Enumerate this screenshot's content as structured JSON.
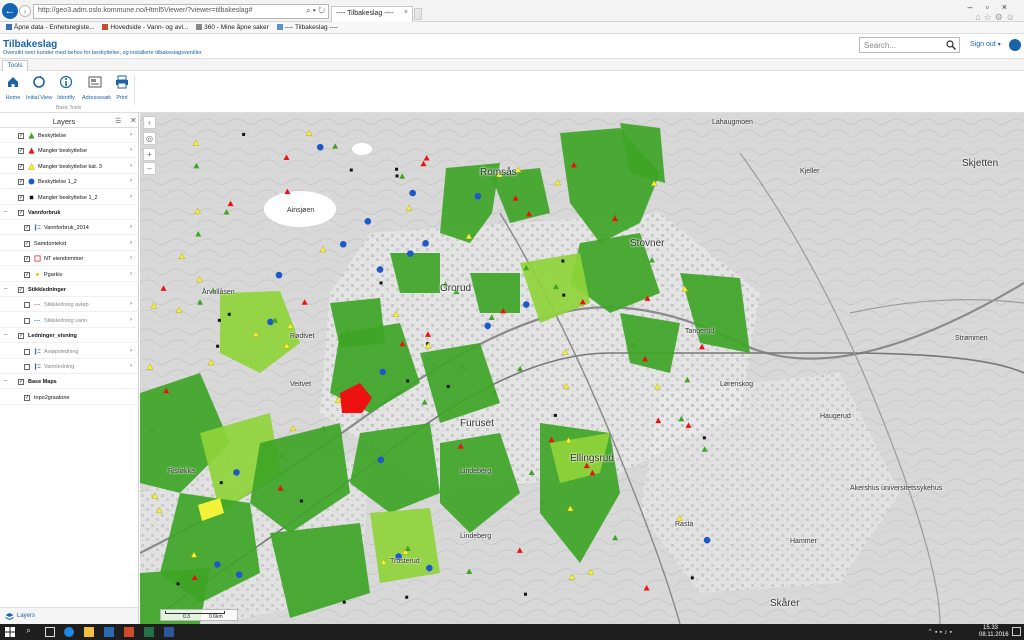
{
  "browser": {
    "address": "http://geo3.adm.oslo.kommune.no/Html5Viewer/?viewer=tilbakeslag#",
    "tab_title": "---- Tilbakeslag ----",
    "favorites": [
      "Åpne data - Enhetsregiste...",
      "Hovedside - Vann- og avl...",
      "360 - Mine åpne saker",
      "---- Tilbakeslag ----"
    ]
  },
  "app": {
    "title": "Tilbakeslag",
    "subtitle": "Oversikt over kunder med behov for beskyttelse, og installerte tilbakeslagsventiler",
    "search_placeholder": "Search...",
    "signout_label": "Sign out"
  },
  "toolbar": {
    "tab_label": "Tools",
    "group_label": "Basic Tools",
    "tools": [
      {
        "label": "Home",
        "icon": "home-icon"
      },
      {
        "label": "Initial View",
        "icon": "initial-view-icon"
      },
      {
        "label": "Identify",
        "icon": "identify-icon"
      },
      {
        "label": "Adressesøk",
        "icon": "address-search-icon"
      },
      {
        "label": "Print",
        "icon": "print-icon"
      }
    ]
  },
  "layers": {
    "title": "Layers",
    "items": [
      {
        "label": "Beskyttelse",
        "symbol": "green-triangle",
        "checked": true
      },
      {
        "label": "Mangler beskyttelse",
        "symbol": "red-triangle",
        "checked": true
      },
      {
        "label": "Mangler beskyttelse kat. 3",
        "symbol": "yellow-triangle",
        "checked": true
      },
      {
        "label": "Beskyttelse 1_2",
        "symbol": "blue-circle",
        "checked": true
      },
      {
        "label": "Mangler beskyttelse 1_2",
        "symbol": "black-square",
        "checked": true
      },
      {
        "label": "Vannforbruk",
        "group": true,
        "checked": true
      },
      {
        "label": "Vannforbruk_2014",
        "symbol": "legend",
        "checked": true
      },
      {
        "label": "Samdontekst",
        "symbol": "none",
        "checked": true
      },
      {
        "label": "NT eiendommer",
        "symbol": "red-outline",
        "checked": true
      },
      {
        "label": "Pgarkiv",
        "symbol": "small-yellow",
        "checked": true
      },
      {
        "label": "Stikkledninger",
        "group": true,
        "checked": true
      },
      {
        "label": "Stikkledning avløp",
        "symbol": "line-pink",
        "checked": false
      },
      {
        "label": "Stikkledning vann",
        "symbol": "line-blue",
        "checked": false
      },
      {
        "label": "Ledninger_visning",
        "group": true,
        "checked": true
      },
      {
        "label": "Avløpsledning",
        "symbol": "legend",
        "checked": false
      },
      {
        "label": "Vannledning",
        "symbol": "legend",
        "checked": false
      },
      {
        "label": "Base Maps",
        "group": true,
        "checked": true
      },
      {
        "label": "topo2graatone",
        "symbol": "none",
        "checked": true
      }
    ],
    "footer_label": "Layers"
  },
  "map": {
    "place_labels": [
      "Lahaugmoen",
      "Skjetten",
      "Ainsjøen",
      "Romsås",
      "Stovner",
      "Grorud",
      "Årvollåsen",
      "Furuset",
      "Lindeberg",
      "Ellingsrud",
      "Kjeller",
      "Strømmen",
      "Lørenskog",
      "Veitvet",
      "Rødtvet",
      "Trosterud",
      "Rasta",
      "Hammer",
      "Skårer",
      "Akershus universitetssykehus",
      "Tangerud",
      "Haugerud",
      "Risløkka",
      "Lindeberg"
    ],
    "scale_labels": [
      "0.3",
      "0.6km"
    ],
    "colors": {
      "dark_green": "#3ea526",
      "light_green": "#8fd439",
      "yellow": "#f2f23a",
      "red": "#ee1111",
      "blue": "#1d59c9"
    }
  },
  "taskbar": {
    "time": "15.33",
    "date": "08.11.2016"
  }
}
